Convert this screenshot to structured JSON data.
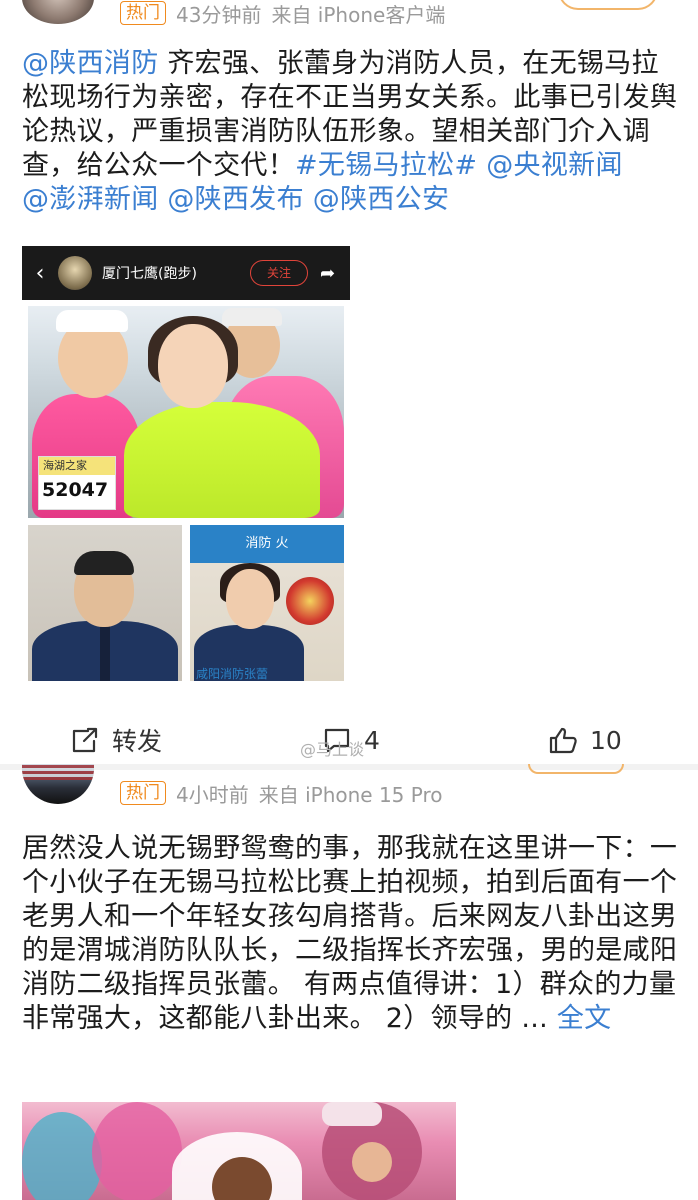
{
  "post1": {
    "badge": "热门",
    "time": "43分钟前",
    "source": "来自 iPhone客户端",
    "text": {
      "mention1": "@陕西消防",
      "body": " 齐宏强、张蕾身为消防人员，在无锡马拉松现场行为亲密，存在不正当男女关系。此事已引发舆论热议，严重损害消防队伍形象。望相关部门介入调查，给公众一个交代！",
      "hashtag": "#无锡马拉松#",
      "mention2": " @央视新闻",
      "mention3": "@澎湃新闻",
      "mention4": " @陕西发布",
      "mention5": " @陕西公安"
    },
    "image": {
      "account_name": "厦门七鹰(跑步)",
      "follow_label": "关注",
      "bib_text": "海湖之家",
      "bib_number": "52047",
      "banner_text": "消防 火",
      "caption": "咸阳消防张蕾"
    },
    "actions": {
      "repost": "转发",
      "comment_count": "4",
      "like_count": "10"
    },
    "watermark": "@马上谈"
  },
  "post2": {
    "badge": "热门",
    "time": "4小时前",
    "source": "来自 iPhone 15 Pro",
    "text": {
      "body": "居然没人说无锡野鸳鸯的事，那我就在这里讲一下：一个小伙子在无锡马拉松比赛上拍视频，拍到后面有一个老男人和一个年轻女孩勾肩搭背。后来网友八卦出这男的是渭城消防队队长，二级指挥长齐宏强，男的是咸阳消防二级指挥员张蕾。 有两点值得讲：1）群众的力量非常强大，这都能八卦出来。 2）领导的 ...",
      "expand": " 全文"
    }
  },
  "colors": {
    "link": "#3b7fd1",
    "badge": "#f08a1e",
    "meta": "#9a9a9a"
  }
}
